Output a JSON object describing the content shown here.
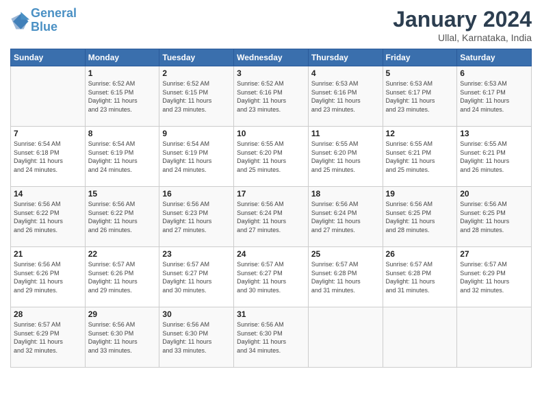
{
  "header": {
    "logo_text_general": "General",
    "logo_text_blue": "Blue",
    "month_title": "January 2024",
    "location": "Ullal, Karnataka, India"
  },
  "days_of_week": [
    "Sunday",
    "Monday",
    "Tuesday",
    "Wednesday",
    "Thursday",
    "Friday",
    "Saturday"
  ],
  "weeks": [
    [
      {
        "day": "",
        "info": ""
      },
      {
        "day": "1",
        "info": "Sunrise: 6:52 AM\nSunset: 6:15 PM\nDaylight: 11 hours\nand 23 minutes."
      },
      {
        "day": "2",
        "info": "Sunrise: 6:52 AM\nSunset: 6:15 PM\nDaylight: 11 hours\nand 23 minutes."
      },
      {
        "day": "3",
        "info": "Sunrise: 6:52 AM\nSunset: 6:16 PM\nDaylight: 11 hours\nand 23 minutes."
      },
      {
        "day": "4",
        "info": "Sunrise: 6:53 AM\nSunset: 6:16 PM\nDaylight: 11 hours\nand 23 minutes."
      },
      {
        "day": "5",
        "info": "Sunrise: 6:53 AM\nSunset: 6:17 PM\nDaylight: 11 hours\nand 23 minutes."
      },
      {
        "day": "6",
        "info": "Sunrise: 6:53 AM\nSunset: 6:17 PM\nDaylight: 11 hours\nand 24 minutes."
      }
    ],
    [
      {
        "day": "7",
        "info": "Sunrise: 6:54 AM\nSunset: 6:18 PM\nDaylight: 11 hours\nand 24 minutes."
      },
      {
        "day": "8",
        "info": "Sunrise: 6:54 AM\nSunset: 6:19 PM\nDaylight: 11 hours\nand 24 minutes."
      },
      {
        "day": "9",
        "info": "Sunrise: 6:54 AM\nSunset: 6:19 PM\nDaylight: 11 hours\nand 24 minutes."
      },
      {
        "day": "10",
        "info": "Sunrise: 6:55 AM\nSunset: 6:20 PM\nDaylight: 11 hours\nand 25 minutes."
      },
      {
        "day": "11",
        "info": "Sunrise: 6:55 AM\nSunset: 6:20 PM\nDaylight: 11 hours\nand 25 minutes."
      },
      {
        "day": "12",
        "info": "Sunrise: 6:55 AM\nSunset: 6:21 PM\nDaylight: 11 hours\nand 25 minutes."
      },
      {
        "day": "13",
        "info": "Sunrise: 6:55 AM\nSunset: 6:21 PM\nDaylight: 11 hours\nand 26 minutes."
      }
    ],
    [
      {
        "day": "14",
        "info": "Sunrise: 6:56 AM\nSunset: 6:22 PM\nDaylight: 11 hours\nand 26 minutes."
      },
      {
        "day": "15",
        "info": "Sunrise: 6:56 AM\nSunset: 6:22 PM\nDaylight: 11 hours\nand 26 minutes."
      },
      {
        "day": "16",
        "info": "Sunrise: 6:56 AM\nSunset: 6:23 PM\nDaylight: 11 hours\nand 27 minutes."
      },
      {
        "day": "17",
        "info": "Sunrise: 6:56 AM\nSunset: 6:24 PM\nDaylight: 11 hours\nand 27 minutes."
      },
      {
        "day": "18",
        "info": "Sunrise: 6:56 AM\nSunset: 6:24 PM\nDaylight: 11 hours\nand 27 minutes."
      },
      {
        "day": "19",
        "info": "Sunrise: 6:56 AM\nSunset: 6:25 PM\nDaylight: 11 hours\nand 28 minutes."
      },
      {
        "day": "20",
        "info": "Sunrise: 6:56 AM\nSunset: 6:25 PM\nDaylight: 11 hours\nand 28 minutes."
      }
    ],
    [
      {
        "day": "21",
        "info": "Sunrise: 6:56 AM\nSunset: 6:26 PM\nDaylight: 11 hours\nand 29 minutes."
      },
      {
        "day": "22",
        "info": "Sunrise: 6:57 AM\nSunset: 6:26 PM\nDaylight: 11 hours\nand 29 minutes."
      },
      {
        "day": "23",
        "info": "Sunrise: 6:57 AM\nSunset: 6:27 PM\nDaylight: 11 hours\nand 30 minutes."
      },
      {
        "day": "24",
        "info": "Sunrise: 6:57 AM\nSunset: 6:27 PM\nDaylight: 11 hours\nand 30 minutes."
      },
      {
        "day": "25",
        "info": "Sunrise: 6:57 AM\nSunset: 6:28 PM\nDaylight: 11 hours\nand 31 minutes."
      },
      {
        "day": "26",
        "info": "Sunrise: 6:57 AM\nSunset: 6:28 PM\nDaylight: 11 hours\nand 31 minutes."
      },
      {
        "day": "27",
        "info": "Sunrise: 6:57 AM\nSunset: 6:29 PM\nDaylight: 11 hours\nand 32 minutes."
      }
    ],
    [
      {
        "day": "28",
        "info": "Sunrise: 6:57 AM\nSunset: 6:29 PM\nDaylight: 11 hours\nand 32 minutes."
      },
      {
        "day": "29",
        "info": "Sunrise: 6:56 AM\nSunset: 6:30 PM\nDaylight: 11 hours\nand 33 minutes."
      },
      {
        "day": "30",
        "info": "Sunrise: 6:56 AM\nSunset: 6:30 PM\nDaylight: 11 hours\nand 33 minutes."
      },
      {
        "day": "31",
        "info": "Sunrise: 6:56 AM\nSunset: 6:30 PM\nDaylight: 11 hours\nand 34 minutes."
      },
      {
        "day": "",
        "info": ""
      },
      {
        "day": "",
        "info": ""
      },
      {
        "day": "",
        "info": ""
      }
    ]
  ]
}
